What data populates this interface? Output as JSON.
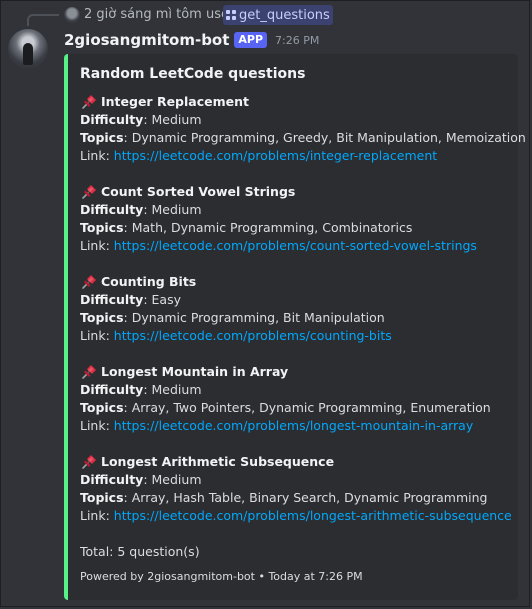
{
  "reply": {
    "text": "2 giờ sáng mì tôm used",
    "command": "get_questions"
  },
  "message": {
    "username": "2giosangmitom-bot",
    "tag": "APP",
    "timestamp": "7:26 PM"
  },
  "embed": {
    "accent_color": "#57f287",
    "title": "Random LeetCode questions",
    "difficulty_label": "Difficulty",
    "topics_label": "Topics",
    "link_label": "Link: ",
    "questions": [
      {
        "title": "Integer Replacement",
        "difficulty": "Medium",
        "topics": "Dynamic Programming, Greedy, Bit Manipulation, Memoization",
        "link": "https://leetcode.com/problems/integer-replacement"
      },
      {
        "title": "Count Sorted Vowel Strings",
        "difficulty": "Medium",
        "topics": "Math, Dynamic Programming, Combinatorics",
        "link": "https://leetcode.com/problems/count-sorted-vowel-strings"
      },
      {
        "title": "Counting Bits",
        "difficulty": "Easy",
        "topics": "Dynamic Programming, Bit Manipulation",
        "link": "https://leetcode.com/problems/counting-bits"
      },
      {
        "title": "Longest Mountain in Array",
        "difficulty": "Medium",
        "topics": "Array, Two Pointers, Dynamic Programming, Enumeration",
        "link": "https://leetcode.com/problems/longest-mountain-in-array"
      },
      {
        "title": "Longest Arithmetic Subsequence",
        "difficulty": "Medium",
        "topics": "Array, Hash Table, Binary Search, Dynamic Programming",
        "link": "https://leetcode.com/problems/longest-arithmetic-subsequence"
      }
    ],
    "total": "Total: 5 question(s)",
    "footer": "Powered by 2giosangmitom-bot • Today at 7:26 PM"
  },
  "icons": {
    "question_marker": "pushpin-icon",
    "command_marker": "slash-command-icon"
  }
}
